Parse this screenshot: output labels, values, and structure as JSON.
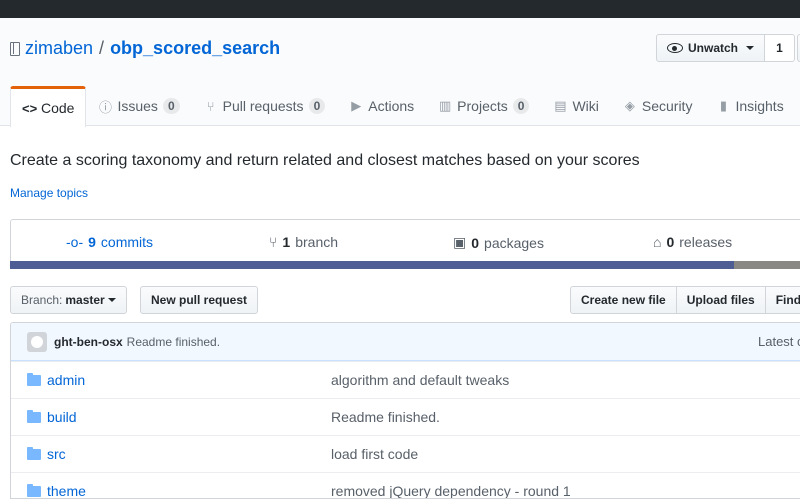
{
  "repo": {
    "owner": "zimaben",
    "separator": "/",
    "name": "obp_scored_search"
  },
  "watch": {
    "label": "Unwatch",
    "count": "1"
  },
  "tabs": [
    {
      "label": "Code",
      "icon": "code-icon"
    },
    {
      "label": "Issues",
      "counter": "0",
      "icon": "issue-icon"
    },
    {
      "label": "Pull requests",
      "counter": "0",
      "icon": "pull-request-icon"
    },
    {
      "label": "Actions",
      "icon": "play-icon"
    },
    {
      "label": "Projects",
      "counter": "0",
      "icon": "project-icon"
    },
    {
      "label": "Wiki",
      "icon": "book-icon"
    },
    {
      "label": "Security",
      "icon": "shield-icon"
    },
    {
      "label": "Insights",
      "icon": "graph-icon"
    }
  ],
  "description": "Create a scoring taxonomy and return related and closest matches based on your scores",
  "manage_topics": "Manage topics",
  "summary": {
    "commits_num": "9",
    "commits_label": "commits",
    "branch_num": "1",
    "branch_label": "branch",
    "packages_num": "0",
    "packages_label": "packages",
    "releases_num": "0",
    "releases_label": "releases"
  },
  "language_colors": {
    "primary": "#4f5d95",
    "secondary": "#8a8883"
  },
  "branch": {
    "prefix": "Branch:",
    "value": "master"
  },
  "buttons": {
    "new_pull_request": "New pull request",
    "create_new_file": "Create new file",
    "upload_files": "Upload files",
    "find_file": "Find"
  },
  "latest_commit": {
    "author": "ght-ben-osx",
    "message": "Readme finished.",
    "latest_label": "Latest c"
  },
  "files": [
    {
      "name": "admin",
      "message": "algorithm and default tweaks"
    },
    {
      "name": "build",
      "message": "Readme finished."
    },
    {
      "name": "src",
      "message": "load first code"
    },
    {
      "name": "theme",
      "message": "removed jQuery dependency - round 1"
    }
  ]
}
